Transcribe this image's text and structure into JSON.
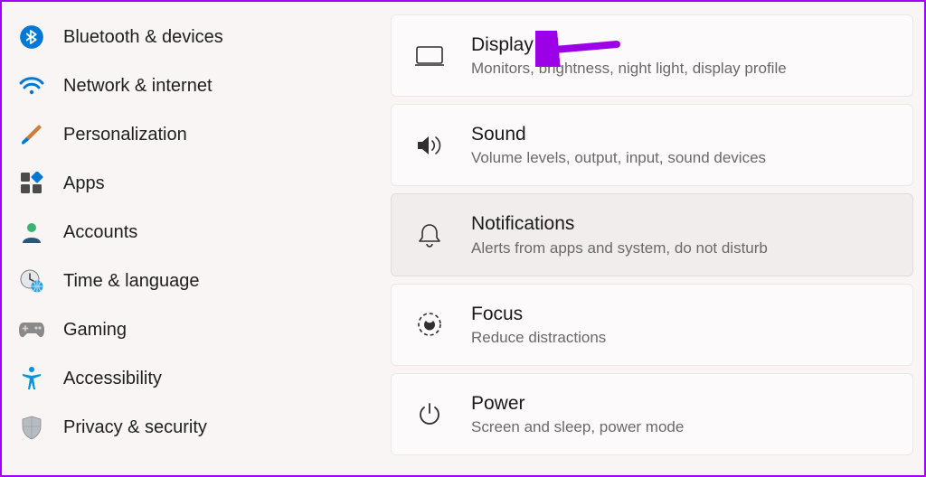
{
  "sidebar": {
    "items": [
      {
        "label": "Bluetooth & devices"
      },
      {
        "label": "Network & internet"
      },
      {
        "label": "Personalization"
      },
      {
        "label": "Apps"
      },
      {
        "label": "Accounts"
      },
      {
        "label": "Time & language"
      },
      {
        "label": "Gaming"
      },
      {
        "label": "Accessibility"
      },
      {
        "label": "Privacy & security"
      }
    ]
  },
  "main": {
    "cards": [
      {
        "title": "Display",
        "desc": "Monitors, brightness, night light, display profile"
      },
      {
        "title": "Sound",
        "desc": "Volume levels, output, input, sound devices"
      },
      {
        "title": "Notifications",
        "desc": "Alerts from apps and system, do not disturb"
      },
      {
        "title": "Focus",
        "desc": "Reduce distractions"
      },
      {
        "title": "Power",
        "desc": "Screen and sleep, power mode"
      }
    ]
  },
  "annotation": {
    "arrow_color": "#9b00e6"
  }
}
